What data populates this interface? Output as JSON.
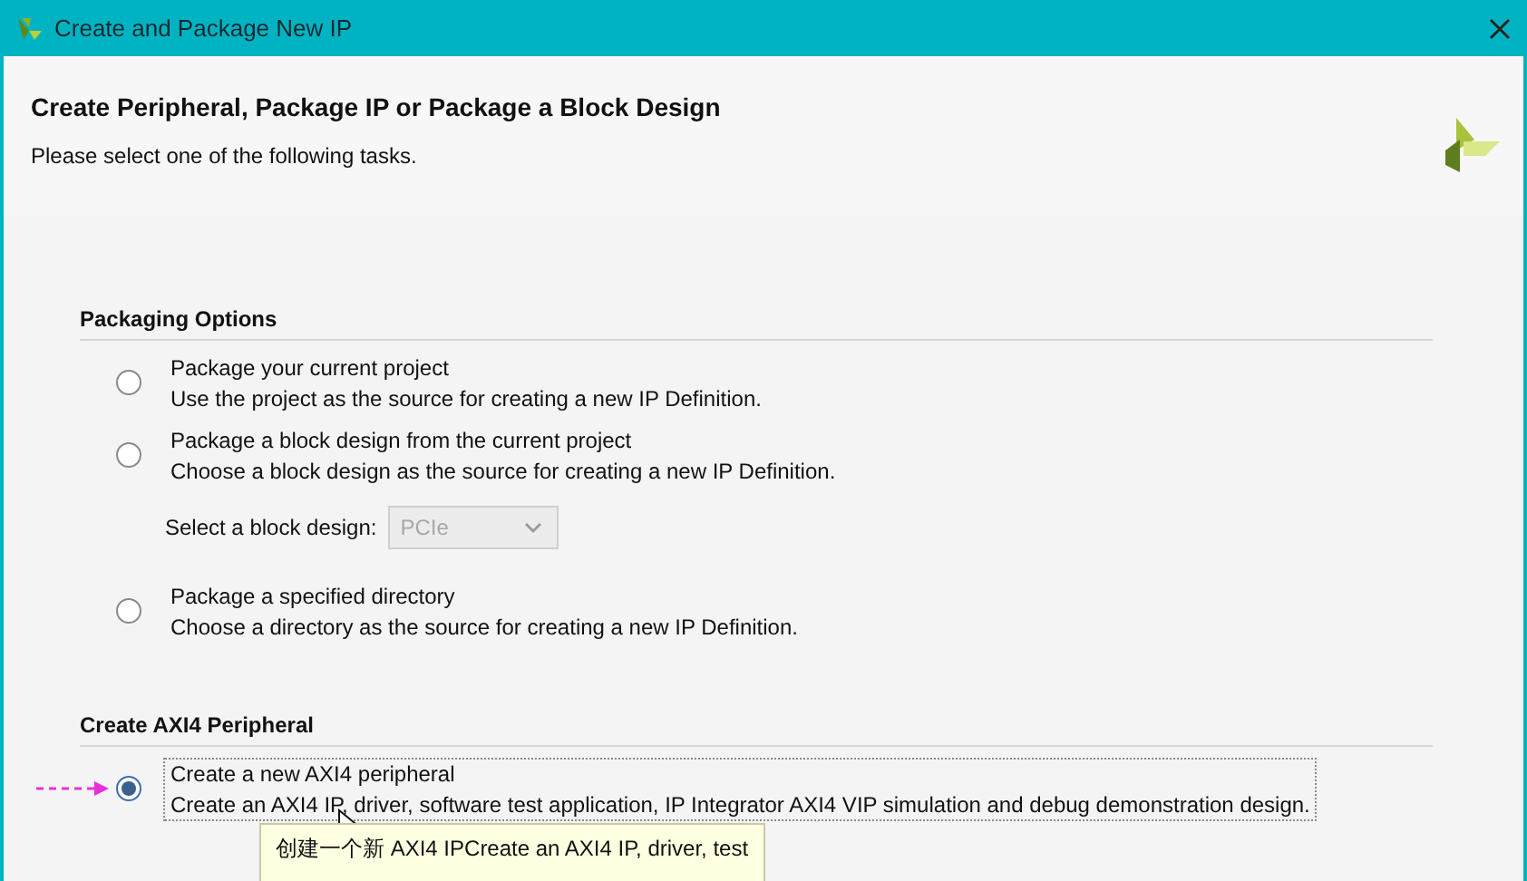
{
  "window": {
    "title": "Create and Package New IP"
  },
  "header": {
    "title": "Create Peripheral, Package IP or Package a Block Design",
    "subtitle": "Please select one of the following tasks."
  },
  "sections": [
    {
      "title": "Packaging Options",
      "options": [
        {
          "label": "Package your current project",
          "description": "Use the project as the source for creating a new IP Definition.",
          "selected": false,
          "focused": false
        },
        {
          "label": "Package a block design from the current project",
          "description": "Choose a block design as the source for creating a new IP Definition.",
          "selected": false,
          "focused": false,
          "select": {
            "label": "Select a block design:",
            "value": "PCIe",
            "disabled": true
          }
        },
        {
          "label": "Package a specified directory",
          "description": "Choose a directory as the source for creating a new IP Definition.",
          "selected": false,
          "focused": false
        }
      ]
    },
    {
      "title": "Create AXI4 Peripheral",
      "options": [
        {
          "label": "Create a new AXI4 peripheral",
          "description": "Create an AXI4 IP, driver, software test application, IP Integrator AXI4 VIP simulation and debug demonstration design.",
          "selected": true,
          "focused": true
        }
      ]
    }
  ],
  "tooltip": {
    "text": "创建一个新 AXI4 IPCreate an AXI4 IP, driver, test"
  }
}
